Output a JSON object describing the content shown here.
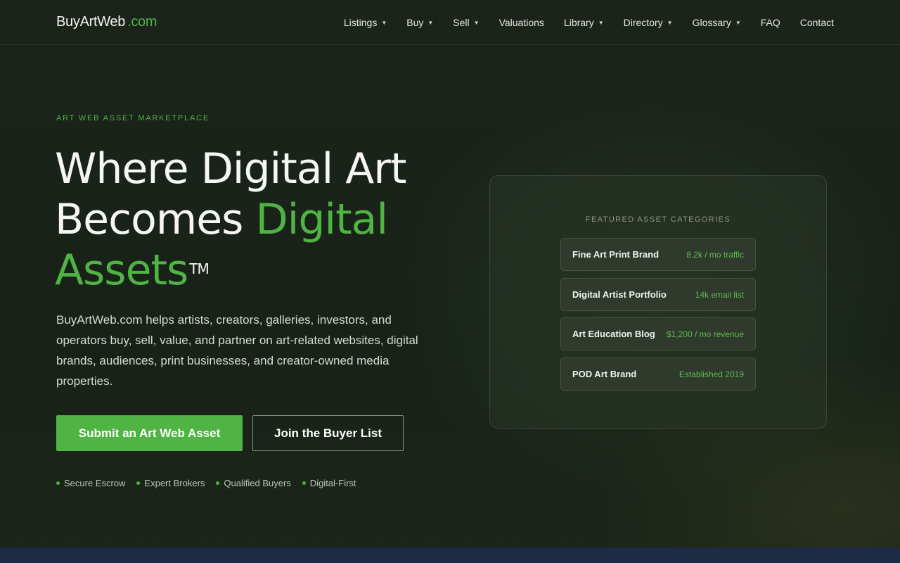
{
  "header": {
    "logo_name": "BuyArtWeb",
    "logo_tld": ".com",
    "nav": [
      {
        "label": "Listings",
        "dropdown": true
      },
      {
        "label": "Buy",
        "dropdown": true
      },
      {
        "label": "Sell",
        "dropdown": true
      },
      {
        "label": "Valuations",
        "dropdown": false
      },
      {
        "label": "Library",
        "dropdown": true
      },
      {
        "label": "Directory",
        "dropdown": true
      },
      {
        "label": "Glossary",
        "dropdown": true
      },
      {
        "label": "FAQ",
        "dropdown": false
      },
      {
        "label": "Contact",
        "dropdown": false
      }
    ],
    "caret_glyph": "▼"
  },
  "hero": {
    "eyebrow": "ART WEB ASSET MARKETPLACE",
    "headline_line1": "Where Digital Art",
    "headline_line2_plain": "Becomes ",
    "headline_line2_accent": "Digital",
    "headline_line3_accent": "Assets",
    "headline_trademark": "TM",
    "lede": "BuyArtWeb.com helps artists, creators, galleries, investors, and operators buy, sell, value, and partner on art-related websites, digital brands, audiences, print businesses, and creator-owned media properties.",
    "primary_cta": "Submit an Art Web Asset",
    "secondary_cta": "Join the Buyer List",
    "features": [
      "Secure Escrow",
      "Expert Brokers",
      "Qualified Buyers",
      "Digital-First"
    ]
  },
  "card": {
    "title": "FEATURED ASSET CATEGORIES",
    "items": [
      {
        "name": "Fine Art Print Brand",
        "metric": "8.2k / mo traffic"
      },
      {
        "name": "Digital Artist Portfolio",
        "metric": "14k email list"
      },
      {
        "name": "Art Education Blog",
        "metric": "$1,200 / mo revenue"
      },
      {
        "name": "POD Art Brand",
        "metric": "Established 2019"
      }
    ]
  },
  "colors": {
    "accent": "#4fb443",
    "background": "#18231a",
    "footer_band": "#1b2c44"
  }
}
